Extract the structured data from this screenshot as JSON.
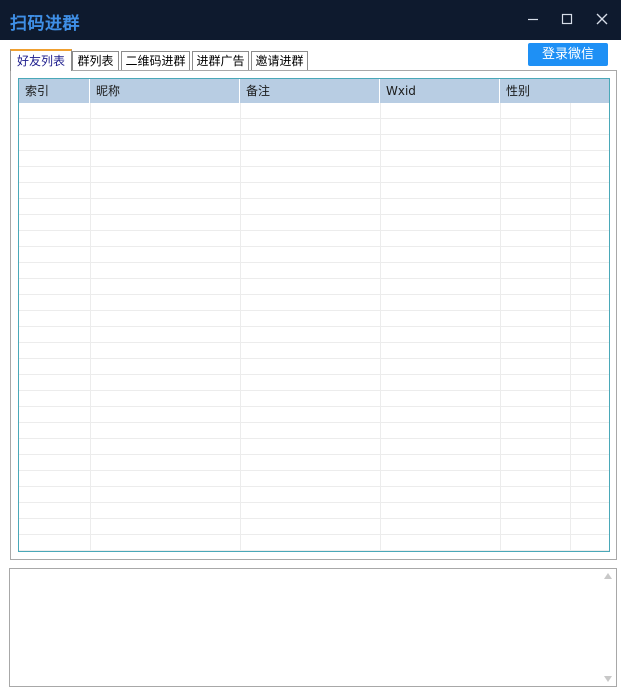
{
  "window": {
    "title": "扫码进群"
  },
  "window_controls": {
    "minimize_glyph": "minimize-icon",
    "maximize_glyph": "maximize-icon",
    "close_glyph": "close-icon"
  },
  "toolbar": {
    "login_label": "登录微信"
  },
  "tabs": [
    {
      "label": "好友列表",
      "active": true
    },
    {
      "label": "群列表",
      "active": false
    },
    {
      "label": "二维码进群",
      "active": false
    },
    {
      "label": "进群广告",
      "active": false
    },
    {
      "label": "邀请进群",
      "active": false
    }
  ],
  "friend_table": {
    "columns": [
      "索引",
      "昵称",
      "备注",
      "Wxid",
      "性别"
    ],
    "rows": []
  },
  "log": {
    "text": ""
  },
  "colors": {
    "titlebar": "#0e1a2e",
    "title_text": "#3f8fe6",
    "login_button": "#1e90f5",
    "header_bg": "#b8cde3",
    "grid_border": "#4aa8b8",
    "active_tab_accent": "#f0a030"
  }
}
